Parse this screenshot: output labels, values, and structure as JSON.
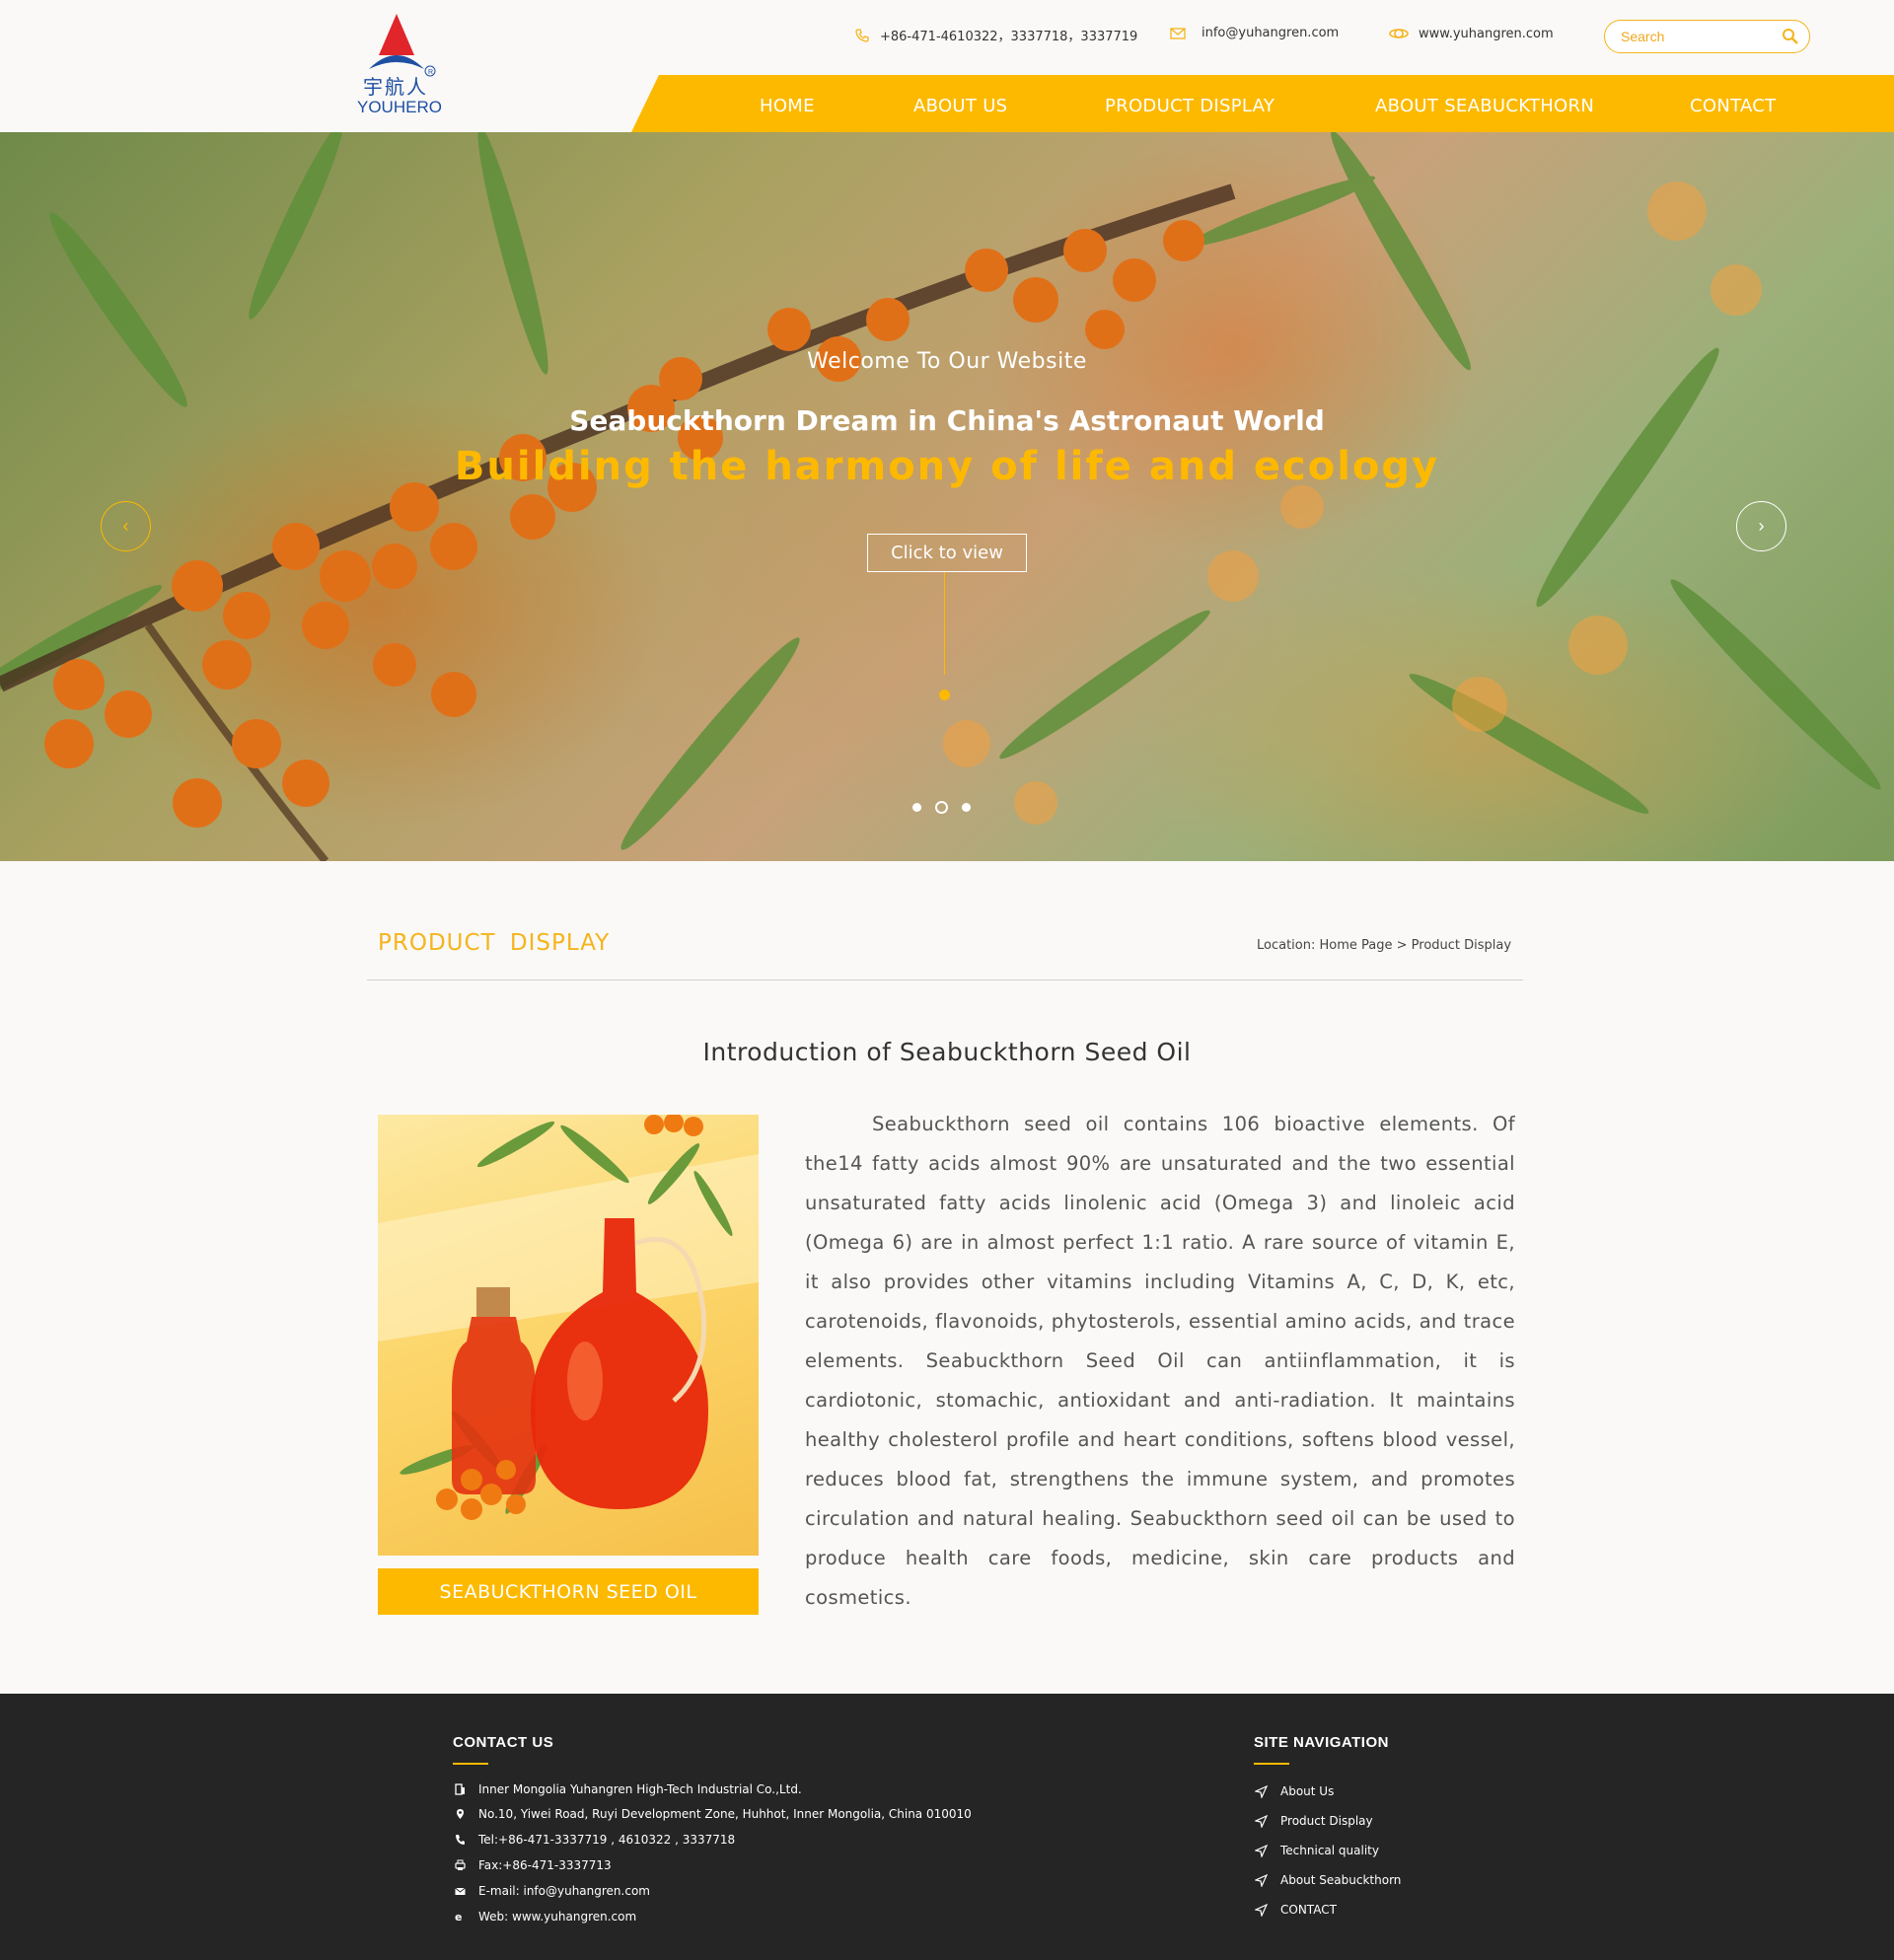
{
  "brand": {
    "logo_cn": "宇航人",
    "logo_en": "YOUHERO",
    "colors": {
      "accent": "#fdb900",
      "logo_blue": "#1f4fa3",
      "logo_red": "#e0262b",
      "footer_bg": "#252525"
    }
  },
  "header": {
    "phone": "+86-471-4610322，3337718，3337719",
    "email": "info@yuhangren.com",
    "website": "www.yuhangren.com",
    "search_placeholder": "Search"
  },
  "nav": {
    "items": [
      {
        "label": "HOME"
      },
      {
        "label": "ABOUT US"
      },
      {
        "label": "PRODUCT DISPLAY"
      },
      {
        "label": "ABOUT SEABUCKTHORN"
      },
      {
        "label": "CONTACT"
      }
    ]
  },
  "hero": {
    "welcome": "Welcome To Our Website",
    "title": "Seabuckthorn Dream in China's Astronaut World",
    "slogan": "Building the harmony of life and ecology",
    "button": "Click to view",
    "prev_symbol": "‹",
    "next_symbol": "›",
    "slide_count": 3,
    "active_slide": 2
  },
  "section": {
    "title": "PRODUCT  DISPLAY",
    "location_prefix": "Location: ",
    "breadcrumb": [
      "Home Page",
      "Product Display"
    ],
    "breadcrumb_sep": " > "
  },
  "product": {
    "intro_title": "Introduction of Seabuckthorn Seed Oil",
    "caption": "SEABUCKTHORN SEED OIL",
    "body": "Seabuckthorn seed oil contains 106 bioactive elements. Of the14 fatty acids almost 90% are unsaturated and the two essential unsaturated fatty acids linolenic acid (Omega 3) and linoleic acid (Omega 6) are in almost perfect 1:1 ratio. A rare source of vitamin E, it also provides other vitamins including Vitamins A, C, D, K, etc, carotenoids, flavonoids, phytosterols, essential amino acids, and trace elements. Seabuckthorn Seed Oil can antiinflammation, it is cardiotonic, stomachic, antioxidant and anti-radiation. It maintains healthy cholesterol profile and heart conditions, softens blood vessel, reduces blood fat, strengthens the immune system, and promotes circulation and natural healing. Seabuckthorn seed oil can be used to produce health care foods, medicine, skin care products and cosmetics."
  },
  "footer": {
    "contact_heading": "CONTACT US",
    "contact_items": [
      {
        "icon": "building-icon",
        "text": "Inner Mongolia Yuhangren High-Tech Industrial Co.,Ltd."
      },
      {
        "icon": "location-pin-icon",
        "text": "No.10, Yiwei Road, Ruyi Development Zone, Huhhot, Inner Mongolia, China 010010"
      },
      {
        "icon": "phone-icon",
        "text": "Tel:+86-471-3337719 , 4610322 , 3337718"
      },
      {
        "icon": "fax-icon",
        "text": "Fax:+86-471-3337713"
      },
      {
        "icon": "mail-icon",
        "text": "E-mail: info@yuhangren.com"
      },
      {
        "icon": "web-icon",
        "text": "Web: www.yuhangren.com"
      }
    ],
    "nav_heading": "SITE NAVIGATION",
    "nav_items": [
      {
        "label": "About Us"
      },
      {
        "label": "Product Display"
      },
      {
        "label": "Technical quality"
      },
      {
        "label": "About Seabuckthorn"
      },
      {
        "label": "CONTACT"
      }
    ]
  }
}
